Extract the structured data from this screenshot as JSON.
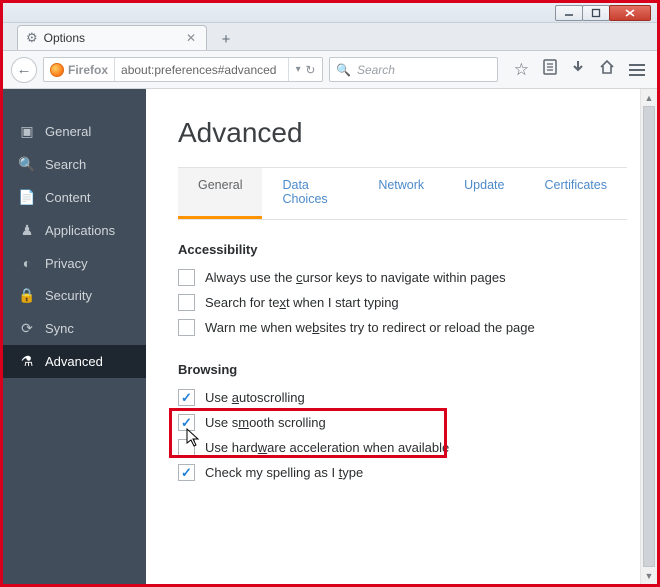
{
  "window": {
    "tab_title": "Options",
    "new_tab_label": "+"
  },
  "navbar": {
    "identity_label": "Firefox",
    "url": "about:preferences#advanced",
    "search_placeholder": "Search"
  },
  "sidebar": {
    "items": [
      {
        "label": "General",
        "icon": "general-icon"
      },
      {
        "label": "Search",
        "icon": "search-icon"
      },
      {
        "label": "Content",
        "icon": "content-icon"
      },
      {
        "label": "Applications",
        "icon": "applications-icon"
      },
      {
        "label": "Privacy",
        "icon": "privacy-icon"
      },
      {
        "label": "Security",
        "icon": "security-icon"
      },
      {
        "label": "Sync",
        "icon": "sync-icon"
      },
      {
        "label": "Advanced",
        "icon": "advanced-icon"
      }
    ],
    "active_index": 7
  },
  "page": {
    "title": "Advanced",
    "tabs": [
      "General",
      "Data Choices",
      "Network",
      "Update",
      "Certificates"
    ],
    "active_tab_index": 0,
    "sections": {
      "accessibility": {
        "heading": "Accessibility",
        "options": [
          {
            "label_pre": "Always use the ",
            "key": "c",
            "label_post": "ursor keys to navigate within pages",
            "checked": false
          },
          {
            "label_pre": "Search for te",
            "key": "x",
            "label_post": "t when I start typing",
            "checked": false
          },
          {
            "label_pre": "Warn me when we",
            "key": "b",
            "label_post": "sites try to redirect or reload the page",
            "checked": false
          }
        ]
      },
      "browsing": {
        "heading": "Browsing",
        "options": [
          {
            "label_pre": "Use ",
            "key": "a",
            "label_post": "utoscrolling",
            "checked": true
          },
          {
            "label_pre": "Use s",
            "key": "m",
            "label_post": "ooth scrolling",
            "checked": true
          },
          {
            "label_pre": "Use hard",
            "key": "w",
            "label_post": "are acceleration when available",
            "checked": false
          },
          {
            "label_pre": "Check my spelling as I ",
            "key": "t",
            "label_post": "ype",
            "checked": true
          }
        ]
      }
    }
  }
}
